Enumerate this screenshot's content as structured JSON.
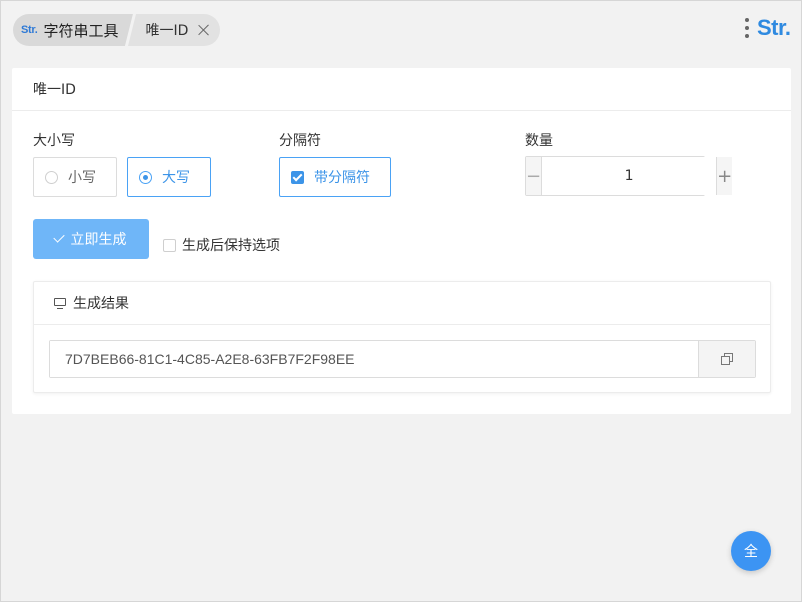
{
  "header": {
    "logo_small": "Str.",
    "home_label": "字符串工具",
    "current_tab": "唯一ID",
    "brand_logo": "Str."
  },
  "card": {
    "title": "唯一ID",
    "case": {
      "label": "大小写",
      "options": [
        "小写",
        "大写"
      ],
      "selected": "大写"
    },
    "separator": {
      "label": "分隔符",
      "option": "带分隔符",
      "checked": true
    },
    "quantity": {
      "label": "数量",
      "value": "1",
      "minus": "−",
      "plus": "+"
    },
    "generate_label": "立即生成",
    "keep_options_label": "生成后保持选项",
    "keep_options_checked": false
  },
  "result": {
    "title": "生成结果",
    "value": "7D7BEB66-81C1-4C85-A2E8-63FB7F2F98EE"
  },
  "fab_label": "全",
  "colors": {
    "accent": "#3c94e8",
    "button": "#6fb6f8",
    "background": "#f2f2f2"
  }
}
